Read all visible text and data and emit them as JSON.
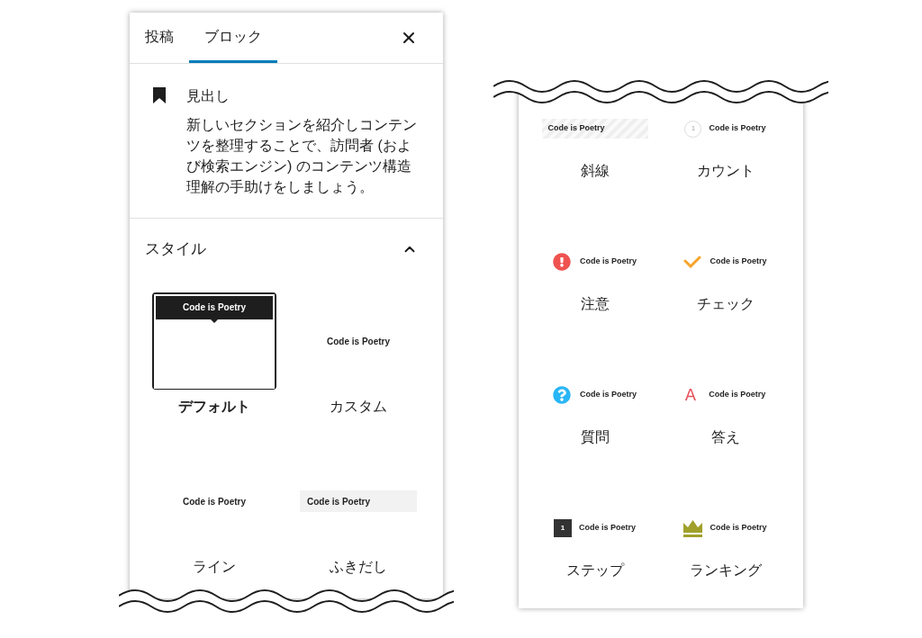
{
  "left_panel": {
    "tabs": [
      {
        "label": "投稿",
        "selected": false
      },
      {
        "label": "ブロック",
        "selected": true
      }
    ],
    "block": {
      "title": "見出し",
      "description": "新しいセクションを紹介しコンテンツを整理することで、訪問者 (および検索エンジン) のコンテンツ構造理解の手助けをしましょう。"
    },
    "styles_section": {
      "title": "スタイル",
      "expanded": true
    },
    "styles": [
      {
        "kind": "default",
        "sample": "Code is Poetry",
        "label": "デフォルト",
        "selected": true
      },
      {
        "kind": "plain",
        "sample": "Code is Poetry",
        "label": "カスタム",
        "selected": false
      },
      {
        "kind": "plain",
        "sample": "Code is Poetry",
        "label": "ライン",
        "selected": false
      },
      {
        "kind": "balloon",
        "sample": "Code is Poetry",
        "label": "ふきだし",
        "selected": false
      }
    ]
  },
  "right_panel": {
    "styles": [
      {
        "kind": "stripe",
        "sample": "Code is Poetry",
        "label": "斜線",
        "selected": false
      },
      {
        "kind": "count",
        "marker": "1",
        "sample": "Code is Poetry",
        "label": "カウント",
        "selected": false
      },
      {
        "kind": "alert",
        "sample": "Code is Poetry",
        "label": "注意",
        "selected": false
      },
      {
        "kind": "check",
        "sample": "Code is Poetry",
        "label": "チェック",
        "selected": false
      },
      {
        "kind": "question",
        "sample": "Code is Poetry",
        "label": "質問",
        "selected": false
      },
      {
        "kind": "answer",
        "marker": "A",
        "sample": "Code is Poetry",
        "label": "答え",
        "selected": false
      },
      {
        "kind": "step",
        "marker": "1",
        "sample": "Code is Poetry",
        "label": "ステップ",
        "selected": false
      },
      {
        "kind": "ranking",
        "sample": "Code is Poetry",
        "label": "ランキング",
        "selected": false
      }
    ]
  }
}
